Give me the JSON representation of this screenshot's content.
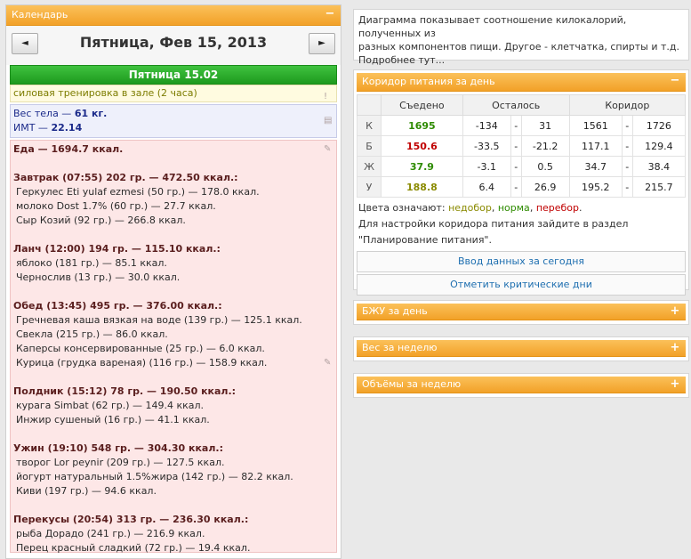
{
  "calendar": {
    "header": "Календарь",
    "toggle": "−",
    "prev": "◄",
    "next": "►",
    "date_title": "Пятница, Фев 15, 2013",
    "day_header": "Пятница 15.02"
  },
  "training": "силовая тренировка в зале (2 часа)",
  "weight": {
    "line1_prefix": "Вес тела — ",
    "line1_value": "61 кг.",
    "line2_prefix": "ИМТ — ",
    "line2_value": "22.14"
  },
  "food": {
    "lines": [
      {
        "t": "Еда — 1694.7 ккал.",
        "k": "meal"
      },
      {
        "t": "",
        "k": "gap"
      },
      {
        "t": "Завтрак (07:55) 202 гр. — 472.50 ккал.:",
        "k": "meal"
      },
      {
        "t": "Геркулес Eti yulaf ezmesi (50 гр.) — 178.0 ккал.",
        "k": "item"
      },
      {
        "t": "молоко Dost 1.7% (60 гр.) — 27.7 ккал.",
        "k": "item"
      },
      {
        "t": "Сыр Козий (92 гр.) — 266.8 ккал.",
        "k": "item"
      },
      {
        "t": "",
        "k": "gap"
      },
      {
        "t": "Ланч (12:00) 194 гр. — 115.10 ккал.:",
        "k": "meal"
      },
      {
        "t": "яблоко (181 гр.) — 85.1 ккал.",
        "k": "item"
      },
      {
        "t": "Чернослив (13 гр.) — 30.0 ккал.",
        "k": "item"
      },
      {
        "t": "",
        "k": "gap"
      },
      {
        "t": "Обед (13:45) 495 гр. — 376.00 ккал.:",
        "k": "meal"
      },
      {
        "t": "Гречневая каша вязкая на воде (139 гр.) — 125.1 ккал.",
        "k": "item"
      },
      {
        "t": "Свекла (215 гр.) — 86.0 ккал.",
        "k": "item"
      },
      {
        "t": "Каперсы консервированные (25 гр.) — 6.0 ккал.",
        "k": "item"
      },
      {
        "t": "Курица (грудка вареная) (116 гр.) — 158.9 ккал.",
        "k": "item"
      },
      {
        "t": "",
        "k": "gap"
      },
      {
        "t": "Полдник (15:12) 78 гр. — 190.50 ккал.:",
        "k": "meal"
      },
      {
        "t": "курага Simbat (62 гр.) — 149.4 ккал.",
        "k": "item"
      },
      {
        "t": "Инжир сушеный (16 гр.) — 41.1 ккал.",
        "k": "item"
      },
      {
        "t": "",
        "k": "gap"
      },
      {
        "t": "Ужин (19:10) 548 гр. — 304.30 ккал.:",
        "k": "meal"
      },
      {
        "t": "творог Lor peynir (209 гр.) — 127.5 ккал.",
        "k": "item"
      },
      {
        "t": "йогурт натуральный 1.5%жира (142 гр.) — 82.2 ккал.",
        "k": "item"
      },
      {
        "t": "Киви (197 гр.) — 94.6 ккал.",
        "k": "item"
      },
      {
        "t": "",
        "k": "gap"
      },
      {
        "t": "Перекусы (20:54) 313 гр. — 236.30 ккал.:",
        "k": "meal"
      },
      {
        "t": "рыба Дорадо (241 гр.) — 216.9 ккал.",
        "k": "item"
      },
      {
        "t": "Перец красный сладкий (72 гр.) — 19.4 ккал.",
        "k": "item"
      }
    ]
  },
  "top_note": {
    "line1": "Диаграмма показывает соотношение килокалорий, полученных из",
    "line2": "разных компонентов пищи. Другое - клетчатка, спирты и т.д.",
    "line3": "Подробнее тут..."
  },
  "corridor": {
    "header": "Коридор питания за день",
    "toggle": "−",
    "col_eaten": "Съедено",
    "col_left": "Осталось",
    "col_corridor": "Коридор",
    "dash": "-",
    "rows": [
      {
        "lab": "К",
        "eaten": "1695",
        "eclass": "green",
        "l1": "-134",
        "l2": "31",
        "c1": "1561",
        "c2": "1726"
      },
      {
        "lab": "Б",
        "eaten": "150.6",
        "eclass": "red",
        "l1": "-33.5",
        "l2": "-21.2",
        "c1": "117.1",
        "c2": "129.4"
      },
      {
        "lab": "Ж",
        "eaten": "37.9",
        "eclass": "green",
        "l1": "-3.1",
        "l2": "0.5",
        "c1": "34.7",
        "c2": "38.4"
      },
      {
        "lab": "У",
        "eaten": "188.8",
        "eclass": "olive",
        "l1": "6.4",
        "l2": "26.9",
        "c1": "195.2",
        "c2": "215.7"
      }
    ],
    "legend_prefix": "Цвета означают: ",
    "legend_under": "недобор",
    "legend_sep1": ", ",
    "legend_norm": "норма",
    "legend_sep2": ", ",
    "legend_over": "перебор",
    "legend_end": ".",
    "note1": "Для настройки коридора питания зайдите в раздел",
    "note2": "\"Планирование питания\".",
    "btn_enter": "Ввод данных за сегодня",
    "btn_critical": "Отметить критические дни"
  },
  "panels": {
    "bju": "БЖУ за день",
    "weight_week": "Вес за неделю",
    "volumes_week": "Объёмы за неделю",
    "toggle": "+"
  },
  "colors": {
    "orange": "#f2a128",
    "green": "#2e8b00",
    "red": "#c00000",
    "olive": "#8a8a00"
  }
}
